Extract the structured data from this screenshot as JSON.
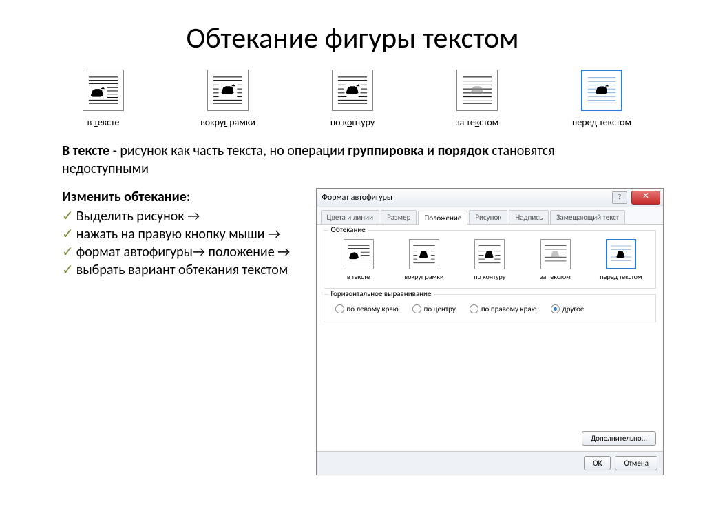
{
  "slide": {
    "title": "Обтекание фигуры текстом",
    "wrap_options": [
      {
        "label_pre": "в ",
        "label_u": "т",
        "label_post": "ексте"
      },
      {
        "label_pre": "вокру",
        "label_u": "г",
        "label_post": " рамки"
      },
      {
        "label_pre": "по к",
        "label_u": "о",
        "label_post": "нтуру"
      },
      {
        "label_pre": "за те",
        "label_u": "к",
        "label_post": "стом"
      },
      {
        "label_pre": "перед текстом",
        "label_u": "",
        "label_post": ""
      }
    ],
    "description_b1": "В тексте",
    "description_mid1": " - рисунок как часть текста, но операции ",
    "description_b2": "группировка",
    "description_mid2": " и ",
    "description_b3": "порядок",
    "description_end": " становятся недоступными",
    "instructions": {
      "title": "Изменить обтекание:",
      "steps": [
        "Выделить рисунок →",
        "нажать на правую кнопку мыши →",
        "формат автофигуры→ положение →",
        "выбрать вариант обтекания текстом"
      ]
    }
  },
  "dialog": {
    "title": "Формат автофигуры",
    "tabs": [
      "Цвета и линии",
      "Размер",
      "Положение",
      "Рисунок",
      "Надпись",
      "Замещающий текст"
    ],
    "active_tab": "Положение",
    "group1_label": "Обтекание",
    "wrap_options_small": [
      "в тексте",
      "вокруг рамки",
      "по контуру",
      "за текстом",
      "перед текстом"
    ],
    "group2_label": "Горизонтальное выравнивание",
    "align_options": [
      "по левому краю",
      "по центру",
      "по правому краю",
      "другое"
    ],
    "align_selected": "другое",
    "advanced_button": "Дополнительно...",
    "ok_button": "ОК",
    "cancel_button": "Отмена"
  }
}
